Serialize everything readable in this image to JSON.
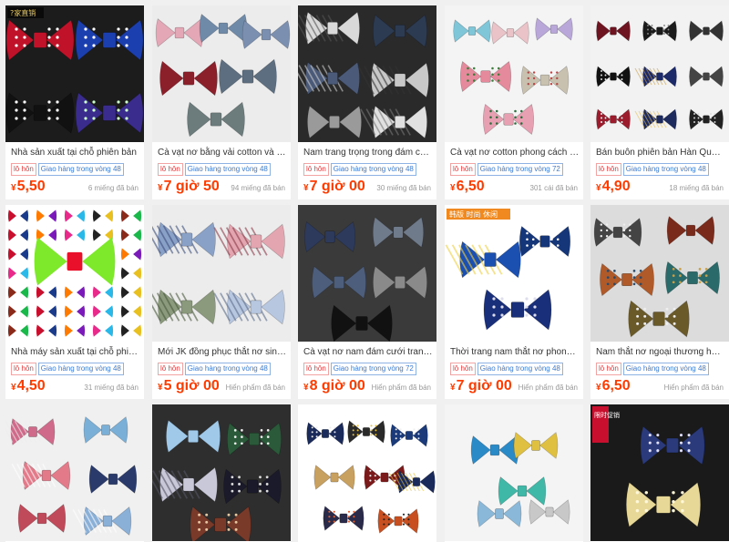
{
  "currency": "¥",
  "products": [
    {
      "title": "Nhà sản xuất tại chỗ phiên bản",
      "tags": [
        "lô hôn",
        "Giao hàng trong vòng 48"
      ],
      "price": "5,50",
      "sold": "6 miếng đã bán",
      "image_text": "?家直销"
    },
    {
      "title": "Cà vạt nơ bằng vải cotton và v...",
      "tags": [
        "lô hôn",
        "Giao hàng trong vòng 48"
      ],
      "price": "7 giờ 50",
      "sold": "94 miếng đã bán"
    },
    {
      "title": "Nam trang trọng trong đám cư...",
      "tags": [
        "lô hôn",
        "Giao hàng trong vòng 48"
      ],
      "price": "7 giờ 00",
      "sold": "30 miếng đã bán"
    },
    {
      "title": "Cà vạt nơ cotton phong cách H...",
      "tags": [
        "lô hôn",
        "Giao hàng trong vòng 72"
      ],
      "price": "6,50",
      "sold": "301 cái đã bán"
    },
    {
      "title": "Bán buôn phiên bản Hàn Quốc...",
      "tags": [
        "lô hôn",
        "Giao hàng trong vòng 48"
      ],
      "price": "4,90",
      "sold": "18 miếng đã bán"
    },
    {
      "title": "Nhà máy sản xuất tại chỗ phiên...",
      "tags": [
        "lô hôn",
        "Giao hàng trong vòng 48"
      ],
      "price": "4,50",
      "sold": "31 miếng đã bán"
    },
    {
      "title": "Mới JK đồng phục thắt nơ sinh ...",
      "tags": [
        "lô hôn",
        "Giao hàng trong vòng 48"
      ],
      "price": "5 giờ 00",
      "sold": "Hiển phẩm đã bán"
    },
    {
      "title": "Cà vạt nơ nam đám cưới trang ...",
      "tags": [
        "lô hôn",
        "Giao hàng trong vòng 72"
      ],
      "price": "8 giờ 00",
      "sold": "Hiển phẩm đã bán"
    },
    {
      "title": "Thời trang nam thắt nơ phong ...",
      "tags": [
        "lô hôn",
        "Giao hàng trong vòng 48"
      ],
      "price": "7 giờ 00",
      "sold": "Hiển phẩm đã bán",
      "image_text": "韩版 时尚 休闲"
    },
    {
      "title": "Nam thắt nơ ngoại thương hoa...",
      "tags": [
        "lô hôn",
        "Giao hàng trong vòng 48"
      ],
      "price": "6,50",
      "sold": "Hiển phẩm đã bán"
    },
    {
      "image_only": true
    },
    {
      "image_only": true
    },
    {
      "image_only": true
    },
    {
      "image_only": true
    },
    {
      "image_only": true,
      "image_text": "限时促销"
    }
  ],
  "colors": {
    "price": "#ff3b00",
    "tag_red": "#e4393c",
    "tag_blue": "#3d7ad0",
    "background": "#f0f0f0"
  },
  "icons": [
    "bow-tie-image"
  ]
}
